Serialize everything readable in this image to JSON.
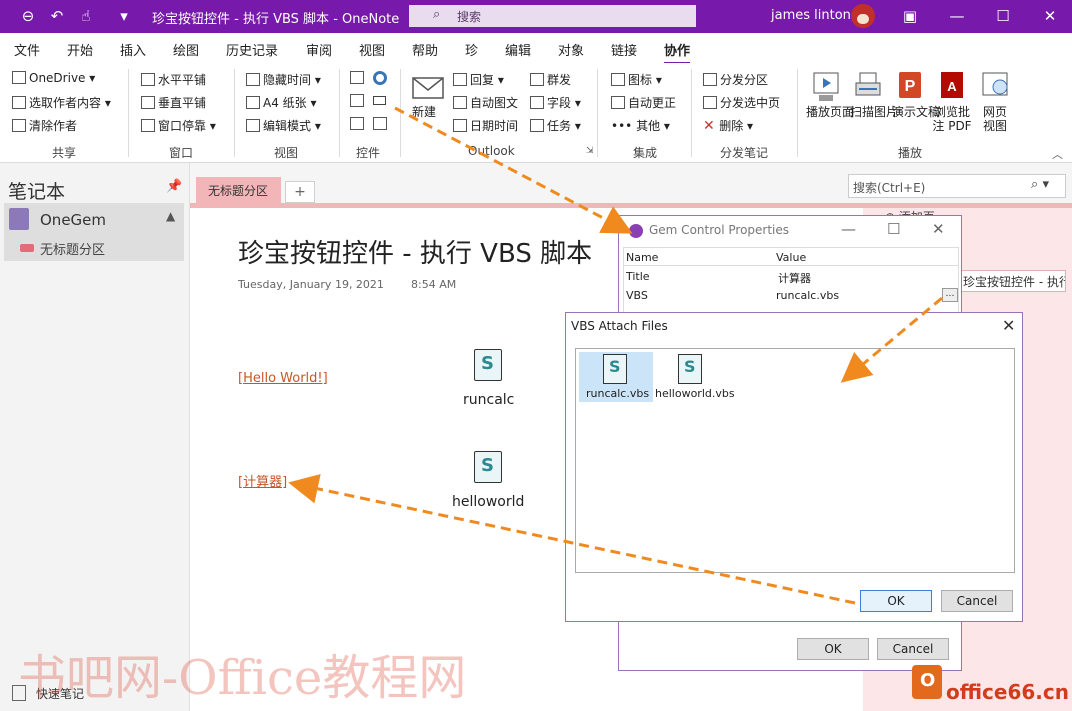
{
  "window": {
    "title": "珍宝按钮控件 - 执行 VBS 脚本 - OneNote",
    "search_placeholder": "搜索",
    "user": "james linton"
  },
  "menu": [
    "文件",
    "开始",
    "插入",
    "绘图",
    "历史记录",
    "审阅",
    "视图",
    "帮助",
    "珍",
    "编辑",
    "对象",
    "链接",
    "协作"
  ],
  "ribbon": {
    "groups": {
      "share": {
        "label": "共享",
        "items": [
          "OneDrive",
          "选取作者内容",
          "清除作者"
        ]
      },
      "window": {
        "label": "窗口",
        "items": [
          "水平平铺",
          "垂直平铺",
          "窗口停靠"
        ]
      },
      "view": {
        "label": "视图",
        "items": [
          "隐藏时间",
          "A4 纸张",
          "编辑模式"
        ]
      },
      "control": {
        "label": "控件"
      },
      "outlook": {
        "label": "Outlook",
        "new_label": "新建",
        "items": [
          "回复",
          "自动图文",
          "日期时间",
          "群发",
          "字段",
          "任务"
        ]
      },
      "integration": {
        "label": "集成",
        "items": [
          "图标",
          "自动更正",
          "其他"
        ]
      },
      "distribute": {
        "label": "分发笔记",
        "items": [
          "分发分区",
          "分发选中页",
          "删除"
        ]
      },
      "play": {
        "label": "播放",
        "items": [
          "播放页面",
          "扫描图片",
          "演示文稿",
          "浏览批注 PDF",
          "网页视图"
        ]
      }
    }
  },
  "notebook": {
    "title": "笔记本",
    "name": "OneGem",
    "section": "无标题分区",
    "quick_notes": "快速笔记"
  },
  "tabs": {
    "section_tab": "无标题分区",
    "add": "+",
    "search_placeholder": "搜索(Ctrl+E)"
  },
  "page": {
    "title": "珍宝按钮控件 - 执行 VBS 脚本",
    "date": "Tuesday, January 19, 2021",
    "time": "8:54 AM",
    "links": [
      "[Hello World!]",
      "[计算器]"
    ],
    "scripts": [
      "runcalc",
      "helloworld"
    ],
    "page_list_item": "珍宝按钮控件 - 执行 VBS 脚本",
    "page_list_add": "添加页"
  },
  "gem_dialog": {
    "title": "Gem Control Properties",
    "columns": [
      "Name",
      "Value"
    ],
    "rows": [
      {
        "name": "Title",
        "value": "计算器"
      },
      {
        "name": "VBS",
        "value": "runcalc.vbs"
      }
    ],
    "ok": "OK",
    "cancel": "Cancel"
  },
  "vbs_dialog": {
    "title": "VBS Attach Files",
    "files": [
      "runcalc.vbs",
      "helloworld.vbs"
    ],
    "ok": "OK",
    "cancel": "Cancel"
  },
  "watermark": "书吧网-Office教程网",
  "logo_text": "office66.cn",
  "logo_mark": "O",
  "colors": {
    "accent": "#7719aa",
    "section": "#f2b6b9",
    "link": "#c8552a",
    "arrow": "#f08a1e"
  }
}
